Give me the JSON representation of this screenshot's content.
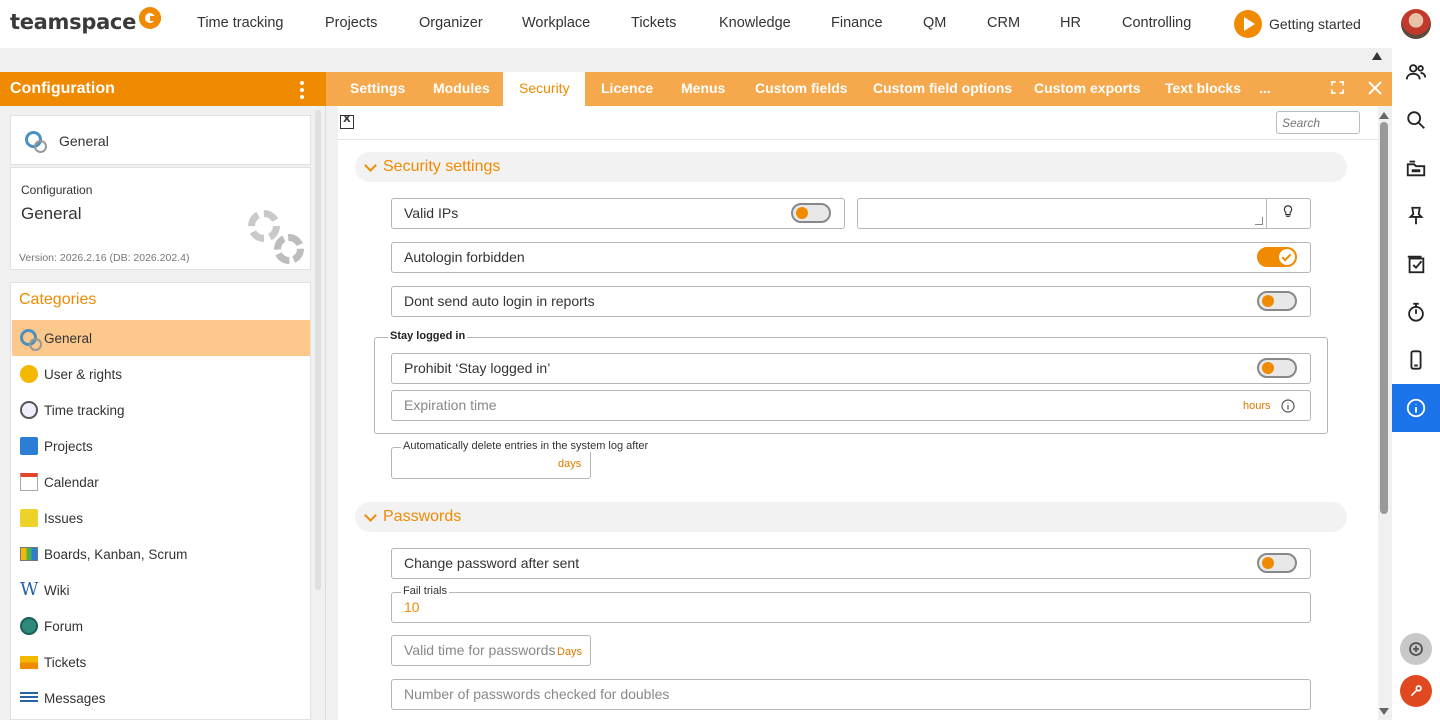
{
  "app": {
    "logo_text": "teamspace"
  },
  "nav": {
    "items": [
      "Time tracking",
      "Projects",
      "Organizer",
      "Workplace",
      "Tickets",
      "Knowledge",
      "Finance",
      "QM",
      "CRM",
      "HR",
      "Controlling"
    ],
    "getting_started": "Getting started"
  },
  "left": {
    "header": "Configuration",
    "top_card_label": "General",
    "info": {
      "caption": "Configuration",
      "title": "General",
      "version": "Version: 2026.2.16 (DB: 2026.202.4)"
    },
    "categories_title": "Categories",
    "categories": [
      "General",
      "User & rights",
      "Time tracking",
      "Projects",
      "Calendar",
      "Issues",
      "Boards, Kanban, Scrum",
      "Wiki",
      "Forum",
      "Tickets",
      "Messages"
    ]
  },
  "tabs": [
    "Settings",
    "Modules",
    "Security",
    "Licence",
    "Menus",
    "Custom fields",
    "Custom field options",
    "Custom exports",
    "Text blocks",
    "..."
  ],
  "toolbar": {
    "search_placeholder": "Search"
  },
  "sections": {
    "security": {
      "title": "Security settings",
      "valid_ips": "Valid IPs",
      "autologin_forbidden": "Autologin forbidden",
      "dont_send_auto_login": "Dont send auto login in reports",
      "stay_logged_in_legend": "Stay logged in",
      "prohibit_stay_logged_in": "Prohibit ‘Stay logged in’",
      "expiration_time": "Expiration time",
      "expiration_unit": "hours",
      "auto_delete_label": "Automatically delete entries in the system log after",
      "auto_delete_unit": "days"
    },
    "passwords": {
      "title": "Passwords",
      "change_after_sent": "Change password after sent",
      "fail_trials_label": "Fail trials",
      "fail_trials_value": "10",
      "valid_time": "Valid time for passwords",
      "valid_time_unit": "Days",
      "doubles_checked": "Number of passwords checked for doubles"
    }
  },
  "toggles": {
    "valid_ips": false,
    "autologin_forbidden": true,
    "dont_send_auto_login": false,
    "prohibit_stay_logged_in": false,
    "change_after_sent": false
  },
  "colors": {
    "accent": "#f08a00",
    "tab_bar": "#f5a84c",
    "active_rail": "#1a73e8",
    "selected_category": "#fdc88c"
  },
  "icons": {
    "rail": [
      "people-icon",
      "search-icon",
      "inbox-icon",
      "pin-icon",
      "tasks-icon",
      "stopwatch-icon",
      "mobile-icon",
      "info-icon"
    ],
    "bottom": [
      "add-circle-icon",
      "wrench-icon"
    ]
  }
}
